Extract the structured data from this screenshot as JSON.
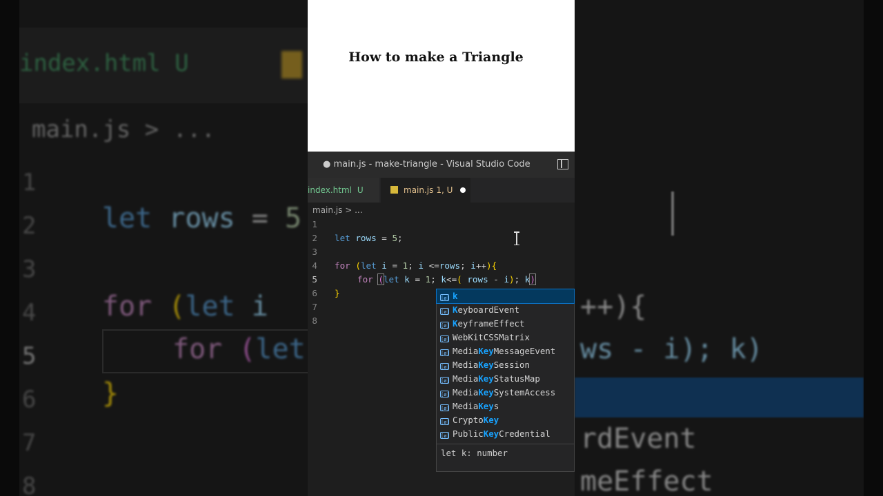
{
  "browser": {
    "page_heading": "How to make a Triangle"
  },
  "window": {
    "title": "● main.js - make-triangle - Visual Studio Code"
  },
  "tabs": [
    {
      "label": "index.html",
      "status": "U"
    },
    {
      "label": "main.js",
      "status": "1, U"
    }
  ],
  "breadcrumb": "main.js > ...",
  "editor": {
    "line_numbers": [
      "1",
      "2",
      "3",
      "4",
      "5",
      "6",
      "7",
      "8"
    ],
    "active_line": 5
  },
  "suggestions": {
    "items": [
      {
        "pre": "",
        "match": "K",
        "post": "",
        "label": "k"
      },
      {
        "pre": "",
        "match": "K",
        "post": "eyboardEvent"
      },
      {
        "pre": "",
        "match": "K",
        "post": "eyframeEffect"
      },
      {
        "pre": "WebKit",
        "match": "",
        "post": "CSSMatrix",
        "pre_hl": "WebKitCSSMatrix"
      },
      {
        "pre": "Media",
        "match": "Key",
        "post": "MessageEvent"
      },
      {
        "pre": "Media",
        "match": "Key",
        "post": "Session"
      },
      {
        "pre": "Media",
        "match": "Key",
        "post": "StatusMap"
      },
      {
        "pre": "Media",
        "match": "Key",
        "post": "SystemAccess"
      },
      {
        "pre": "Media",
        "match": "Key",
        "post": "s"
      },
      {
        "pre": "Crypto",
        "match": "Key",
        "post": ""
      },
      {
        "pre": "Public",
        "match": "Key",
        "post": "Credential"
      }
    ],
    "detail": "let k: number"
  },
  "background": {
    "left_tab": "index.html U",
    "left_breadcrumb": "main.js > ...",
    "left_numbers": [
      "1",
      "2",
      "3",
      "4",
      "5",
      "6",
      "7",
      "8"
    ],
    "right_items": [
      "++){",
      "ws - i); k)",
      "rdEvent",
      "meEffect"
    ]
  },
  "colors": {
    "selection": "#04395e",
    "match_highlight": "#18a3ff",
    "untracked": "#73c991",
    "modified": "#e2c08d"
  }
}
